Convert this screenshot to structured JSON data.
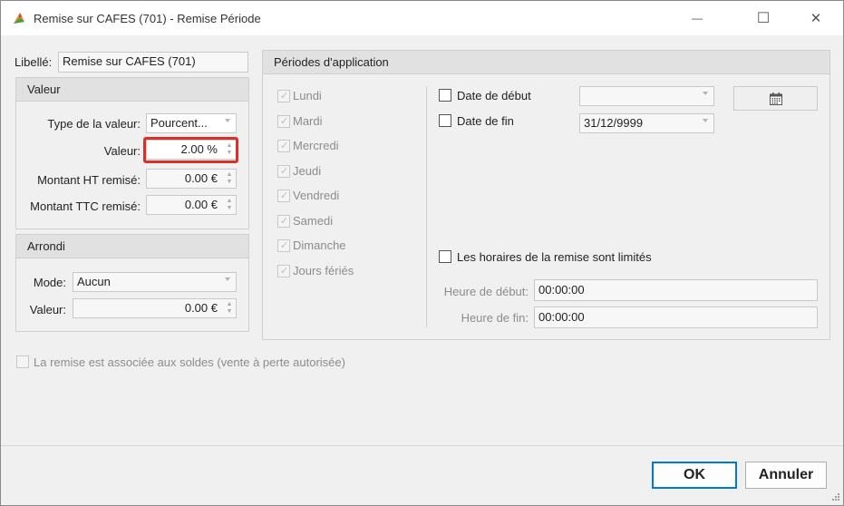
{
  "window": {
    "title": "Remise sur CAFES (701) - Remise Période",
    "minimize_glyph": "—",
    "maximize_glyph": "☐",
    "close_glyph": "✕"
  },
  "libelle": {
    "label": "Libellé:",
    "value": "Remise sur CAFES (701)"
  },
  "valeur_group": {
    "title": "Valeur",
    "type_label": "Type de la valeur:",
    "type_value": "Pourcent...",
    "valeur_label": "Valeur:",
    "valeur_value": "2.00 %",
    "ht_label": "Montant HT remisé:",
    "ht_value": "0.00 €",
    "ttc_label": "Montant TTC remisé:",
    "ttc_value": "0.00 €"
  },
  "arrondi_group": {
    "title": "Arrondi",
    "mode_label": "Mode:",
    "mode_value": "Aucun",
    "valeur_label": "Valeur:",
    "valeur_value": "0.00 €"
  },
  "periodes": {
    "title": "Périodes d'application",
    "days": [
      {
        "label": "Lundi",
        "checked": true
      },
      {
        "label": "Mardi",
        "checked": true
      },
      {
        "label": "Mercredi",
        "checked": true
      },
      {
        "label": "Jeudi",
        "checked": true
      },
      {
        "label": "Vendredi",
        "checked": true
      },
      {
        "label": "Samedi",
        "checked": true
      },
      {
        "label": "Dimanche",
        "checked": true
      },
      {
        "label": "Jours fériés",
        "checked": true
      }
    ],
    "date_debut_label": "Date de début",
    "date_debut_value": "",
    "date_fin_label": "Date de fin",
    "date_fin_value": "31/12/9999",
    "horaires_label": "Les horaires de la remise sont limités",
    "heure_debut_label": "Heure de début:",
    "heure_debut_value": "00:00:00",
    "heure_fin_label": "Heure de fin:",
    "heure_fin_value": "00:00:00"
  },
  "soldes_label": "La remise est associée aux soldes (vente à perte autorisée)",
  "buttons": {
    "ok": "OK",
    "cancel": "Annuler"
  },
  "colors": {
    "accent": "#0078d7",
    "highlight": "#d9302a"
  }
}
